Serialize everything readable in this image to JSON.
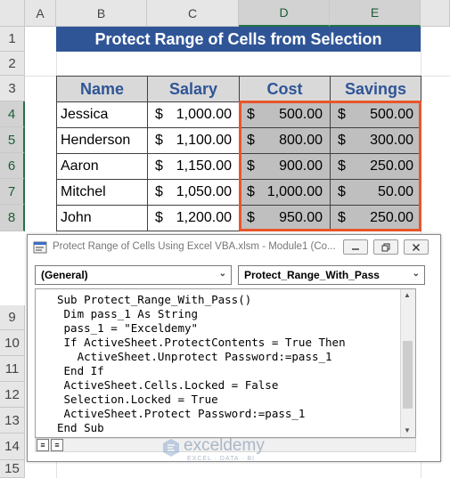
{
  "spreadsheet": {
    "columns": [
      "A",
      "B",
      "C",
      "D",
      "E"
    ],
    "rows": [
      "1",
      "2",
      "3",
      "4",
      "5",
      "6",
      "7",
      "8",
      "9",
      "10",
      "11",
      "12",
      "13",
      "14",
      "15"
    ],
    "title": "Protect Range of Cells from Selection",
    "headers": [
      "Name",
      "Salary",
      "Cost",
      "Savings"
    ],
    "currency": "$",
    "data": [
      {
        "name": "Jessica",
        "salary": "1,000.00",
        "cost": "500.00",
        "savings": "500.00"
      },
      {
        "name": "Henderson",
        "salary": "1,100.00",
        "cost": "800.00",
        "savings": "300.00"
      },
      {
        "name": "Aaron",
        "salary": "1,150.00",
        "cost": "900.00",
        "savings": "250.00"
      },
      {
        "name": "Mitchel",
        "salary": "1,050.00",
        "cost": "1,000.00",
        "savings": "50.00"
      },
      {
        "name": "John",
        "salary": "1,200.00",
        "cost": "950.00",
        "savings": "250.00"
      }
    ],
    "selection_color": "#e8562a",
    "header_color": "#2f5597"
  },
  "vbe": {
    "title": "Protect Range of Cells Using Excel VBA.xlsm - Module1 (Co...",
    "object_dropdown": "(General)",
    "procedure_dropdown": "Protect_Range_With_Pass",
    "code_lines": [
      "Sub Protect_Range_With_Pass()",
      " Dim pass_1 As String",
      " pass_1 = \"Exceldemy\"",
      " If ActiveSheet.ProtectContents = True Then",
      "   ActiveSheet.Unprotect Password:=pass_1",
      " End If",
      " ActiveSheet.Cells.Locked = False",
      " Selection.Locked = True",
      " ActiveSheet.Protect Password:=pass_1",
      "End Sub"
    ]
  },
  "watermark": {
    "name": "exceldemy",
    "tagline": "EXCEL · DATA · BI"
  }
}
